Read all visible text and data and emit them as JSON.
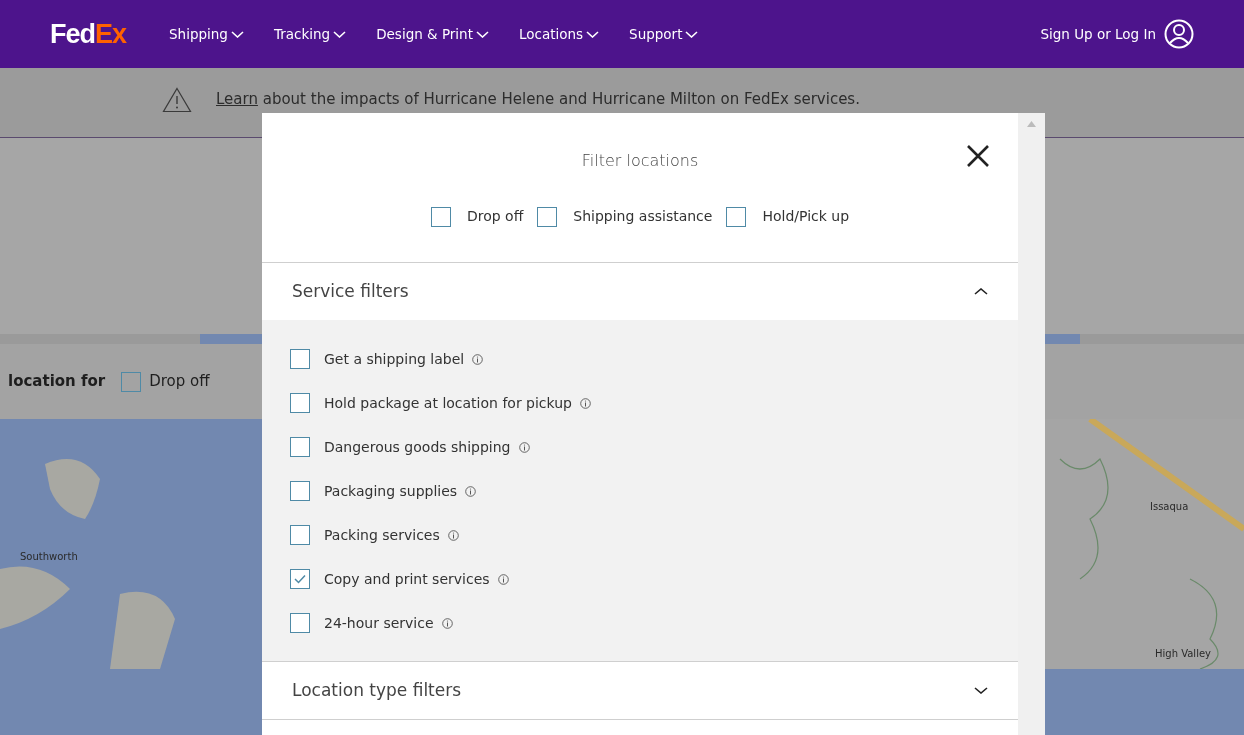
{
  "navbar": {
    "logo": {
      "first": "Fed",
      "second": "Ex"
    },
    "items": [
      {
        "label": "Shipping"
      },
      {
        "label": "Tracking"
      },
      {
        "label": "Design & Print"
      },
      {
        "label": "Locations"
      },
      {
        "label": "Support"
      }
    ],
    "account": "Sign Up or Log In"
  },
  "alert": {
    "link": "Learn",
    "text": " about the impacts of Hurricane Helene and Hurricane Milton on FedEx services."
  },
  "background": {
    "search_label": "location for",
    "option": {
      "label": "Drop off",
      "checked": false
    },
    "map_labels": [
      {
        "text": "Southworth"
      },
      {
        "text": "Issaqua"
      },
      {
        "text": "High Valley"
      }
    ]
  },
  "modal": {
    "title": "Filter locations",
    "type_filters": [
      {
        "label": "Drop off",
        "checked": false
      },
      {
        "label": "Shipping assistance",
        "checked": false
      },
      {
        "label": "Hold/Pick up",
        "checked": false
      }
    ],
    "sections": [
      {
        "title": "Service filters",
        "expanded": true,
        "items": [
          {
            "label": "Get a shipping label",
            "checked": false
          },
          {
            "label": "Hold package at location for pickup",
            "checked": false
          },
          {
            "label": "Dangerous goods shipping",
            "checked": false
          },
          {
            "label": "Packaging supplies",
            "checked": false
          },
          {
            "label": "Packing services",
            "checked": false
          },
          {
            "label": "Copy and print services",
            "checked": true
          },
          {
            "label": "24-hour service",
            "checked": false
          }
        ]
      },
      {
        "title": "Location type filters",
        "expanded": false
      }
    ]
  }
}
